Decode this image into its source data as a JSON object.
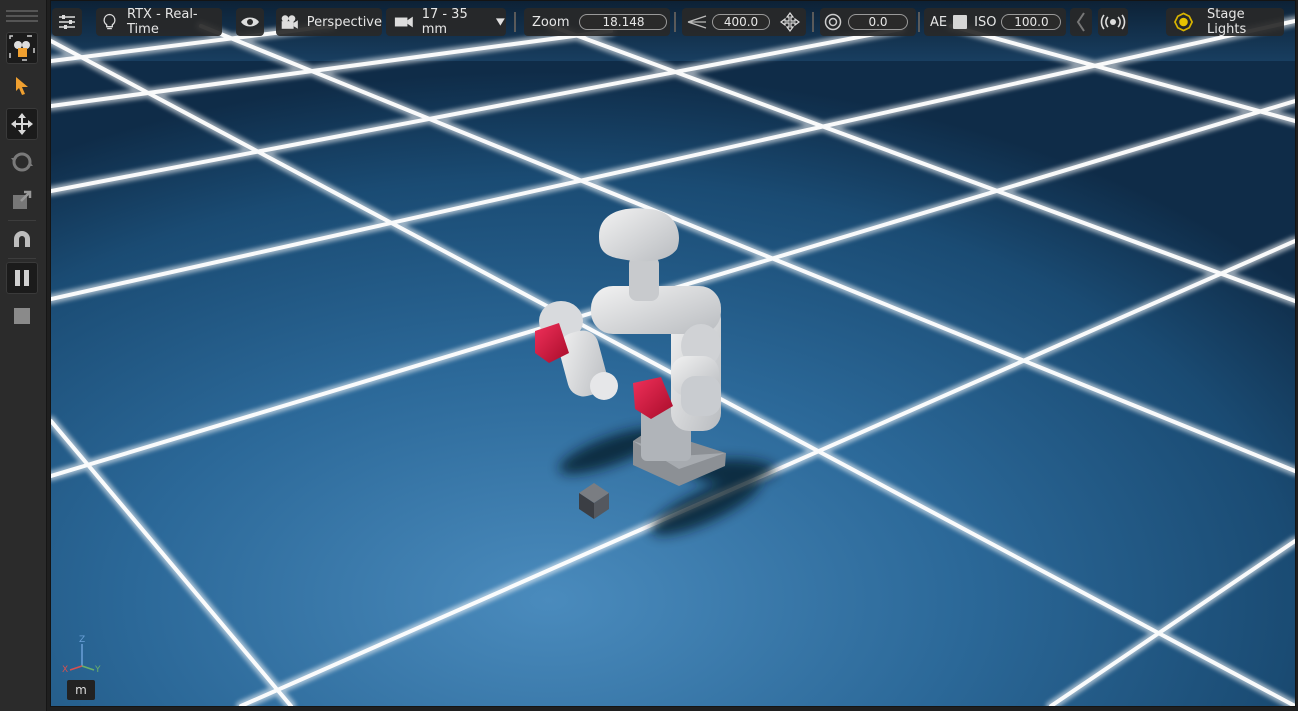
{
  "toolbar": {
    "render_mode_label": "RTX - Real-Time",
    "camera_label": "Perspective",
    "lens_label": "17 - 35 mm",
    "zoom_label": "Zoom",
    "zoom_value": "18.148",
    "fov_value": "400.0",
    "exposure_value": "0.0",
    "ae_label": "AE",
    "iso_label": "ISO",
    "iso_value": "100.0",
    "stage_lights_label": "Stage Lights"
  },
  "left_tools": [
    {
      "name": "select-mode-icon",
      "active": true
    },
    {
      "name": "select-arrow-icon",
      "active": false
    },
    {
      "name": "move-icon",
      "active": true
    },
    {
      "name": "rotate-icon",
      "active": false
    },
    {
      "name": "scale-icon",
      "active": false
    },
    {
      "name": "snap-magnet-icon",
      "active": false
    },
    {
      "name": "pause-icon",
      "active": true
    },
    {
      "name": "stop-icon",
      "active": false
    }
  ],
  "viewport": {
    "units_label": "m",
    "axis_labels": {
      "x": "X",
      "y": "Y",
      "z": "Z"
    }
  },
  "colors": {
    "accent": "#f0a030",
    "toolbar_bg": "#282828",
    "floor_blue": "#2a6a98",
    "robot_red": "#d8143a"
  }
}
